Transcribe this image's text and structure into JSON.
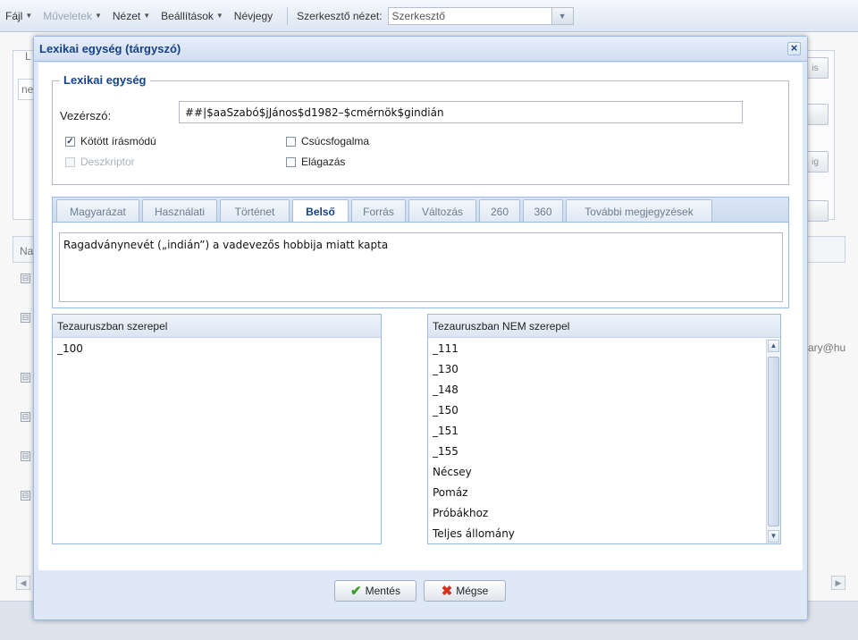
{
  "menubar": {
    "items": [
      {
        "label": "Fájl",
        "disabled": false
      },
      {
        "label": "Műveletek",
        "disabled": true
      },
      {
        "label": "Nézet",
        "disabled": false
      },
      {
        "label": "Beállítások",
        "disabled": false
      },
      {
        "label": "Névjegy",
        "disabled": false
      }
    ],
    "view_label": "Szerkesztő nézet:",
    "view_value": "Szerkesztő"
  },
  "background": {
    "fragments": [
      "L",
      "ne",
      "Na",
      "is",
      "ig",
      "ary@hu"
    ]
  },
  "dialog": {
    "title": "Lexikai egység (tárgyszó)",
    "close_symbol": "×",
    "fieldset_legend": "Lexikai egység",
    "headword_label": "Vezérszó:",
    "headword_value": "##|$aaSzabó$jJános$d1982–$cmérnök$gindián",
    "checkboxes": {
      "bound": {
        "label": "Kötött írásmódú",
        "checked": true,
        "disabled": false
      },
      "descriptor": {
        "label": "Deszkriptor",
        "checked": false,
        "disabled": true
      },
      "top_concept": {
        "label": "Csúcsfogalma",
        "checked": false,
        "disabled": false
      },
      "branching": {
        "label": "Elágazás",
        "checked": false,
        "disabled": false
      }
    },
    "tabs": [
      {
        "label": "Magyarázat"
      },
      {
        "label": "Használati"
      },
      {
        "label": "Történet"
      },
      {
        "label": "Belső",
        "active": true
      },
      {
        "label": "Forrás"
      },
      {
        "label": "Változás"
      },
      {
        "label": "260"
      },
      {
        "label": "360"
      },
      {
        "label": "További megjegyzések"
      }
    ],
    "tab_content": "Ragadványnevét („indián”) a vadevezős hobbija miatt kapta",
    "in_thesaurus": {
      "header": "Tezauruszban szerepel",
      "rows": [
        "_100"
      ]
    },
    "not_in_thesaurus": {
      "header": "Tezauruszban NEM szerepel",
      "rows": [
        "_111",
        "_130",
        "_148",
        "_150",
        "_151",
        "_155",
        "Nécsey",
        "Pomáz",
        "Próbákhoz",
        "Teljes állomány"
      ]
    },
    "buttons": {
      "save": "Mentés",
      "cancel": "Mégse"
    }
  }
}
